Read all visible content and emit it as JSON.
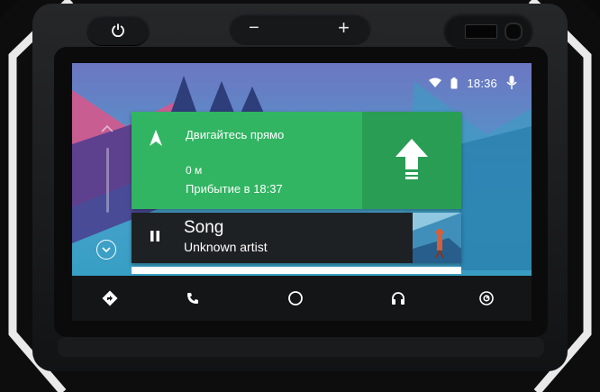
{
  "status": {
    "time": "18:36",
    "wifi_icon": "wifi-icon",
    "battery_icon": "battery-icon",
    "mic_icon": "mic-icon"
  },
  "hardware": {
    "minus_label": "−",
    "plus_label": "+",
    "power_icon": "power-icon"
  },
  "navigation": {
    "instruction": "Двигайтесь прямо",
    "distance": "0 м",
    "arrival": "Прибытие в 18:37",
    "maneuver_icon": "straight-arrow-icon"
  },
  "media": {
    "title": "Song",
    "artist": "Unknown artist",
    "state_icon": "pause-icon"
  },
  "bottom_nav": [
    {
      "name": "navigation",
      "icon": "directions-icon"
    },
    {
      "name": "phone",
      "icon": "phone-icon"
    },
    {
      "name": "home",
      "icon": "home-circle-icon"
    },
    {
      "name": "audio",
      "icon": "headphones-icon"
    },
    {
      "name": "exit",
      "icon": "exit-icon"
    }
  ],
  "colors": {
    "nav_card": "#31b562",
    "nav_turn_panel": "#2a9d55",
    "media_card": "#1e2124",
    "bottom_bar": "#141517",
    "sky": "#32a8c6"
  }
}
